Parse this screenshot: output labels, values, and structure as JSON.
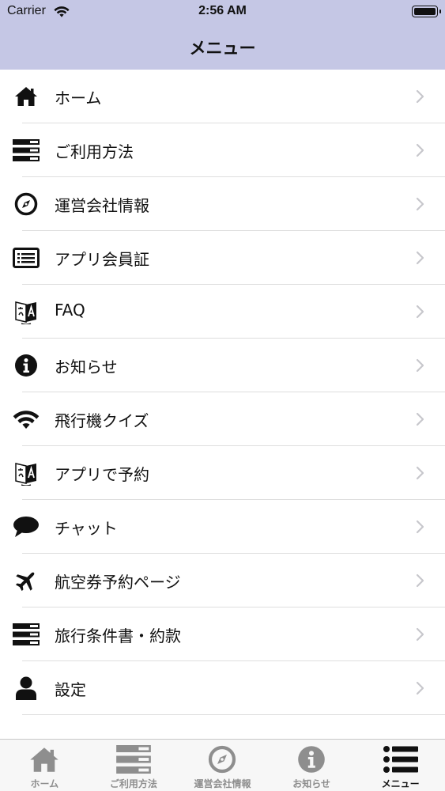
{
  "status_bar": {
    "carrier": "Carrier",
    "time": "2:56 AM"
  },
  "nav": {
    "title": "メニュー"
  },
  "menu": {
    "items": [
      {
        "label": "ホーム",
        "icon": "home-icon"
      },
      {
        "label": "ご利用方法",
        "icon": "list-bars-icon"
      },
      {
        "label": "運営会社情報",
        "icon": "compass-icon"
      },
      {
        "label": "アプリ会員証",
        "icon": "card-list-icon"
      },
      {
        "label": "FAQ",
        "icon": "translate-icon"
      },
      {
        "label": "お知らせ",
        "icon": "info-icon"
      },
      {
        "label": "飛行機クイズ",
        "icon": "wifi-icon"
      },
      {
        "label": "アプリで予約",
        "icon": "translate-icon"
      },
      {
        "label": "チャット",
        "icon": "chat-bubble-icon"
      },
      {
        "label": "航空券予約ページ",
        "icon": "airplane-icon"
      },
      {
        "label": "旅行条件書・約款",
        "icon": "list-bars-icon"
      },
      {
        "label": "設定",
        "icon": "user-icon"
      }
    ]
  },
  "tab_bar": {
    "tabs": [
      {
        "label": "ホーム",
        "icon": "home-icon",
        "active": false
      },
      {
        "label": "ご利用方法",
        "icon": "list-bars-icon",
        "active": false
      },
      {
        "label": "運営会社情報",
        "icon": "compass-icon",
        "active": false
      },
      {
        "label": "お知らせ",
        "icon": "info-icon",
        "active": false
      },
      {
        "label": "メニュー",
        "icon": "menu-list-icon",
        "active": true
      }
    ]
  },
  "colors": {
    "header_bg": "#c5c7e5",
    "tab_inactive": "#8e8e8e",
    "tab_active": "#111111",
    "chevron": "#c7c7cc"
  }
}
